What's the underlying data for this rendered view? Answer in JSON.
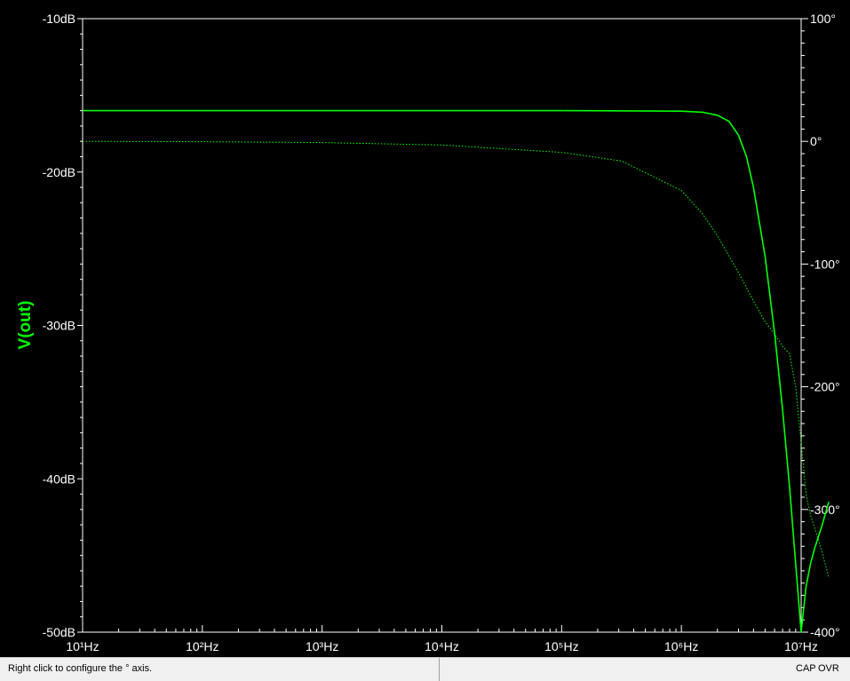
{
  "window": {
    "status_message": "Right click to configure the ° axis.",
    "caps_indicator": "CAP",
    "ovr_indicator": "OVR"
  },
  "colors": {
    "background": "#000000",
    "grid_frame": "#ffffff",
    "trace": "#00ff00",
    "axis_text": "#ffffff"
  },
  "chart_data": {
    "type": "line",
    "ylabel": "V(out)",
    "x_scale": "log",
    "x_ticks": [
      {
        "value": 10,
        "label": "10¹Hz"
      },
      {
        "value": 100,
        "label": "10²Hz"
      },
      {
        "value": 1000,
        "label": "10³Hz"
      },
      {
        "value": 10000,
        "label": "10⁴Hz"
      },
      {
        "value": 100000,
        "label": "10⁵Hz"
      },
      {
        "value": 1000000,
        "label": "10⁶Hz"
      },
      {
        "value": 10000000,
        "label": "10⁷Hz"
      }
    ],
    "xlim": [
      10,
      10000000
    ],
    "y_left": {
      "unit": "dB",
      "ylim": [
        -50,
        -10
      ],
      "ticks": [
        {
          "value": -10,
          "label": "-10dB"
        },
        {
          "value": -20,
          "label": "-20dB"
        },
        {
          "value": -30,
          "label": "-30dB"
        },
        {
          "value": -40,
          "label": "-40dB"
        },
        {
          "value": -50,
          "label": "-50dB"
        }
      ]
    },
    "y_right": {
      "unit": "deg",
      "ylim": [
        -400,
        100
      ],
      "ticks": [
        {
          "value": 100,
          "label": "100°"
        },
        {
          "value": 0,
          "label": "0°"
        },
        {
          "value": -100,
          "label": "-100°"
        },
        {
          "value": -200,
          "label": "-200°"
        },
        {
          "value": -300,
          "label": "-300°"
        },
        {
          "value": -400,
          "label": "-400°"
        }
      ]
    },
    "grid": false,
    "series": [
      {
        "axis": "left",
        "style": "solid",
        "x": [
          10,
          100,
          1000,
          10000,
          100000,
          1000000,
          1500000,
          2000000,
          2500000,
          3000000,
          3500000,
          4000000,
          5000000,
          6000000,
          7000000,
          8000000,
          9000000,
          10000000,
          11000000,
          12000000,
          13000000,
          15000000,
          17000000
        ],
        "y": [
          -16.0,
          -16.0,
          -16.0,
          -16.0,
          -16.0,
          -16.03,
          -16.1,
          -16.3,
          -16.7,
          -17.6,
          -19.0,
          -21.0,
          -25.5,
          -30.5,
          -35.5,
          -40.5,
          -45.5,
          -50.0,
          -47.0,
          -45.5,
          -44.5,
          -43.0,
          -41.5
        ]
      },
      {
        "axis": "right",
        "style": "dotted",
        "x": [
          10,
          100,
          1000,
          10000,
          100000,
          316000,
          1000000,
          1500000,
          2000000,
          3000000,
          4000000,
          5000000,
          6000000,
          7000000,
          8000000,
          9000000,
          10000000,
          11000000,
          12000000,
          14000000,
          17000000
        ],
        "y": [
          0,
          -0.3,
          -1,
          -3,
          -9,
          -16,
          -40,
          -59,
          -77,
          -107,
          -130,
          -147,
          -157,
          -167,
          -173,
          -200,
          -245,
          -288,
          -305,
          -325,
          -355
        ]
      }
    ]
  }
}
